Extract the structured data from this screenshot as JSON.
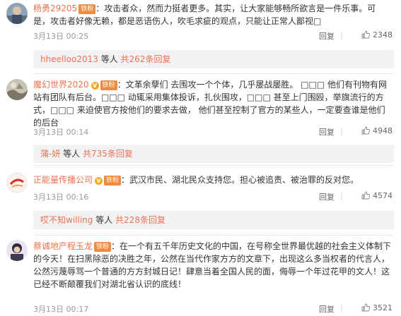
{
  "comments": [
    {
      "user": "杨勇29205",
      "badge": "铁粉",
      "text": "：攻击者众，然而力挺者更多。其实，让大家能够畅所欲言是一件乐事。可是，攻击者好像无赖，都是恶语伤人，吹毛求疵的观点，只能让正常人鄙视□",
      "time": "3月13日 00:25",
      "reply_label": "回复",
      "likes": "2348",
      "replies": {
        "users": "hheelloo2013",
        "connector": "等人",
        "count": "共262条回复"
      }
    },
    {
      "user": "魔幻世界2020",
      "badge": "铁粉",
      "v_mark": "V",
      "text": "：文革余孽们 去围攻一个个体，几乎屡战屡胜。 □□□ 他们有刊物有网站有团队有后台。□□□ 动辄采用集体投诉，扎伙围攻，□□□ 甚至上门围殴，举旗流行的方式，□□□ 来迫使官方按他们的要求去做， 他们甚至控制了官方的某些人，一定要查谁是他们的后台",
      "time": "3月13日 00:14",
      "reply_label": "回复",
      "likes": "4948",
      "replies": {
        "users": "蒲-妍",
        "connector": "等人",
        "count": "共735条回复"
      }
    },
    {
      "user": "正能量传播公司",
      "badge": "铁粉",
      "v_mark": "V",
      "text": "：武汉市民、湖北民众支持您。担心被追责、被治罪的反对您。",
      "time": "3月13日 00:16",
      "reply_label": "回复",
      "likes": "4574",
      "replies": {
        "users": "哎不知willing",
        "connector": "等人",
        "count": "共228条回复"
      }
    },
    {
      "user": "蔡诚地产程玉龙",
      "badge": "铁粉",
      "text": "：在一个有五千年历史文化的中国，在号称全世界最优越的社会主义体制下的今天！在扫黑除恶的决胜之年，公然在当代作家方方的文章下，出现这么多当权者的代言人，公然污蔑辱骂一个普通的方方封城日记！肆意当着全国人民的面，侮辱一个年过花甲的文人！这已经不断颠覆我们对湖北省认识的底线！",
      "time": "3月13日 00:17",
      "reply_label": "回复",
      "likes": "3521"
    }
  ],
  "colors": {
    "link": "#eb7350",
    "badge": "#f08a3c",
    "meta": "#999999",
    "reply_bg": "#f2f2f5"
  },
  "icons": {
    "like": "thumbs-up-icon"
  }
}
